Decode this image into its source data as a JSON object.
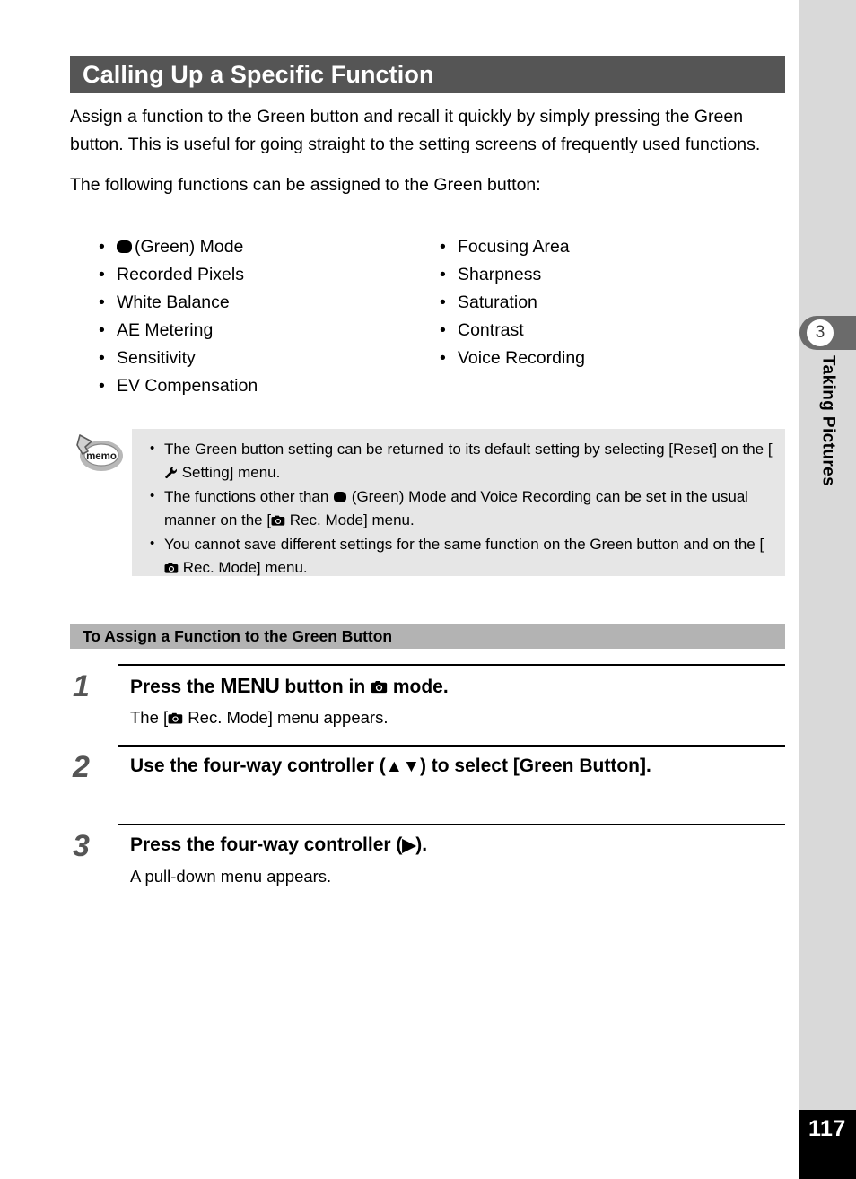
{
  "page": {
    "number": "117",
    "chapter_number": "3",
    "chapter_title": "Taking Pictures"
  },
  "header": {
    "title": "Calling Up a Specific Function"
  },
  "intro": {
    "paragraph_1": "Assign a function to the Green button and recall it quickly by simply pressing the Green button. This is useful for going straight to the setting screens of frequently used functions.",
    "paragraph_2": "The following functions can be assigned to the Green button:"
  },
  "function_list": {
    "left_column": [
      {
        "icon": "green-mode-icon",
        "label": "(Green) Mode"
      },
      {
        "icon": "",
        "label": "Recorded Pixels"
      },
      {
        "icon": "",
        "label": "White Balance"
      },
      {
        "icon": "",
        "label": "AE Metering"
      },
      {
        "icon": "",
        "label": "Sensitivity"
      },
      {
        "icon": "",
        "label": "EV Compensation"
      }
    ],
    "right_column": [
      {
        "icon": "",
        "label": "Focusing Area"
      },
      {
        "icon": "",
        "label": "Sharpness"
      },
      {
        "icon": "",
        "label": "Saturation"
      },
      {
        "icon": "",
        "label": "Contrast"
      },
      {
        "icon": "",
        "label": "Voice Recording"
      }
    ]
  },
  "memo": {
    "icon_label": "memo",
    "items": [
      {
        "part_1": "The Green button setting can be returned to its default setting by selecting [Reset] on the [",
        "icon": "wrench-setting-icon",
        "part_2": " Setting] menu."
      },
      {
        "part_1": "The functions other than ",
        "icon": "green-mode-icon",
        "part_2": " (Green) Mode and Voice Recording can be set in the usual manner on the [",
        "icon_2": "camera-rec-icon",
        "part_3": " Rec. Mode] menu."
      },
      {
        "part_1": "You cannot save different settings for the same function on the Green button and on the [",
        "icon": "camera-rec-icon",
        "part_2": " Rec. Mode] menu."
      }
    ]
  },
  "section": {
    "subheading": "To Assign a Function to the Green Button"
  },
  "steps": [
    {
      "number": "1",
      "headline_part_1": "Press the ",
      "headline_menu": "MENU",
      "headline_part_2": " button in ",
      "headline_icon": "camera-rec-icon",
      "headline_part_3": " mode.",
      "detail_part_1": "The [",
      "detail_icon": "camera-rec-icon",
      "detail_part_2": " Rec. Mode] menu appears."
    },
    {
      "number": "2",
      "headline_part_1": "Use the four-way controller (",
      "headline_arrows": "▲▼",
      "headline_part_2": ") to select [Green Button].",
      "detail_part_1": "",
      "detail_part_2": ""
    },
    {
      "number": "3",
      "headline_part_1": "Press the four-way controller (",
      "headline_arrows": "▶",
      "headline_part_2": ").",
      "detail_part_1": "A pull-down menu appears.",
      "detail_part_2": ""
    }
  ],
  "colors": {
    "title_bar": "#555555",
    "subhead_bar": "#b3b3b3",
    "memo_bg": "#e6e6e6",
    "side_rail": "#d9d9d9",
    "chapter_tab": "#6b6b6b",
    "page_block": "#000000",
    "step_number": "#555555"
  }
}
